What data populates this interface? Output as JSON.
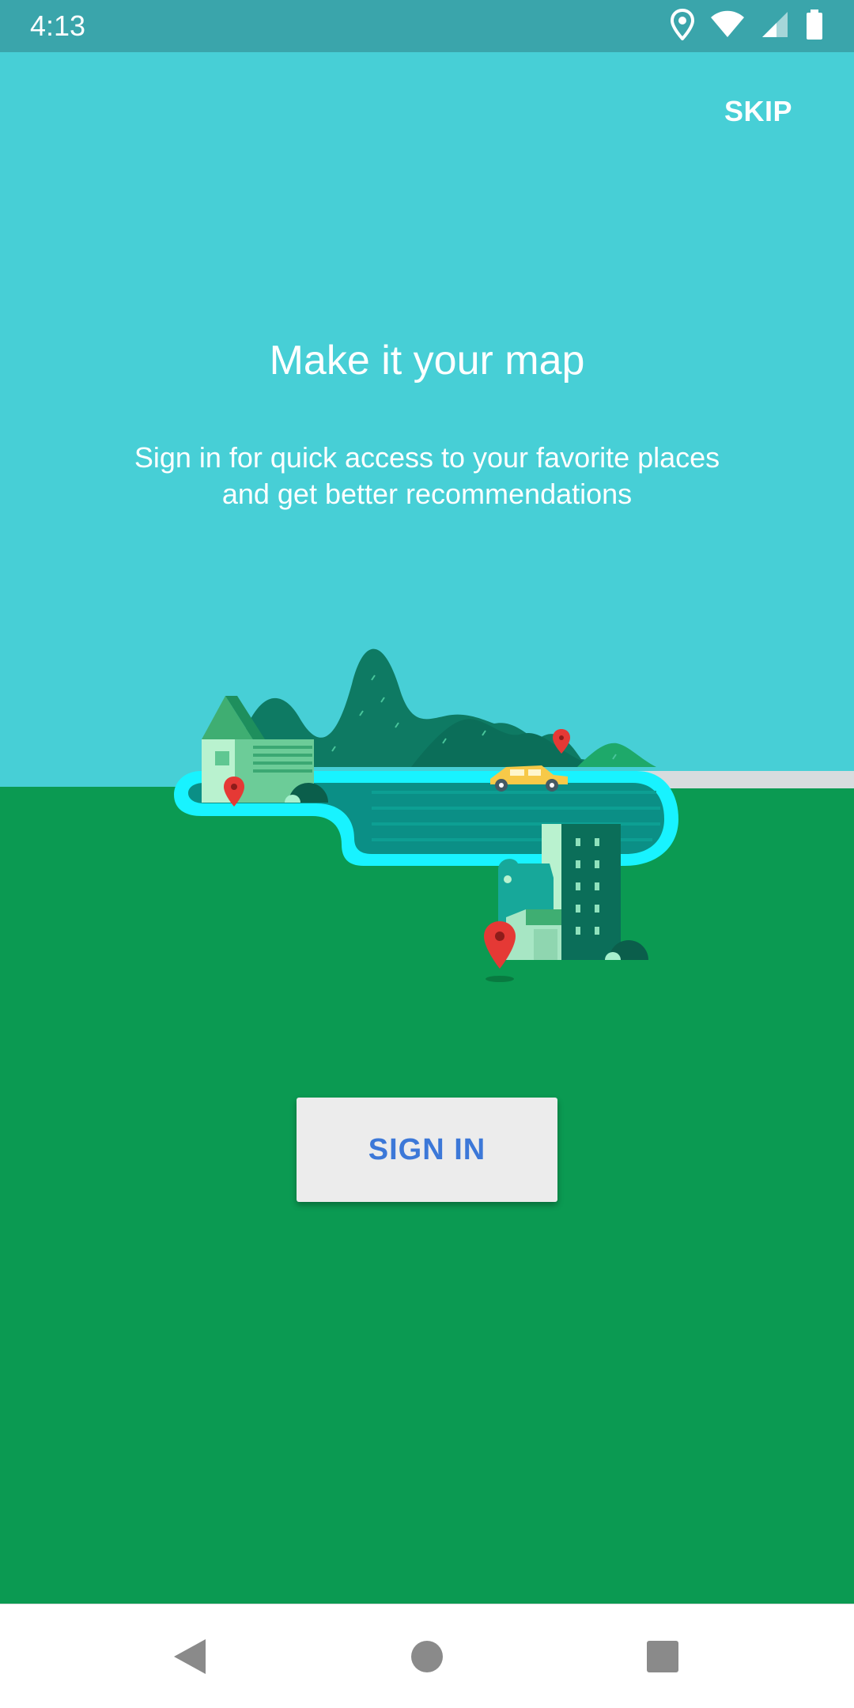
{
  "status_bar": {
    "time": "4:13",
    "icons": [
      "location-icon",
      "wifi-icon",
      "cell-signal-icon",
      "battery-icon"
    ]
  },
  "header": {
    "skip_label": "SKIP"
  },
  "intro": {
    "title": "Make it your map",
    "subtitle_line1": "Sign in for quick access to your favorite places",
    "subtitle_line2": "and get better recommendations"
  },
  "actions": {
    "sign_in_label": "SIGN IN"
  },
  "nav_bar": {
    "buttons": [
      "back-icon",
      "home-icon",
      "recents-icon"
    ]
  },
  "colors": {
    "sky": "#47cfd6",
    "ground": "#0b9a52",
    "status_bar": "#3aa5ab",
    "accent_text": "#3c78d8",
    "button_bg": "#ececec",
    "river": "#18f3ff",
    "pin": "#e53935"
  }
}
